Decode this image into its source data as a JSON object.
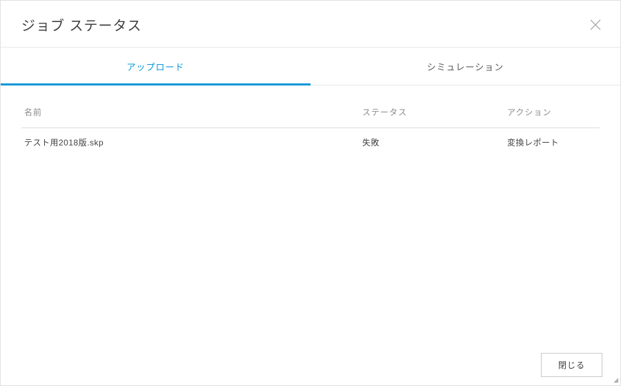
{
  "header": {
    "title": "ジョブ ステータス"
  },
  "tabs": {
    "upload": {
      "label": "アップロード",
      "active": true
    },
    "simulation": {
      "label": "シミュレーション",
      "active": false
    }
  },
  "table": {
    "headers": {
      "name": "名前",
      "status": "ステータス",
      "action": "アクション"
    },
    "rows": [
      {
        "name": "テスト用2018版.skp",
        "status": "失敗",
        "action": "変換レポート"
      }
    ]
  },
  "footer": {
    "close_label": "閉じる"
  }
}
